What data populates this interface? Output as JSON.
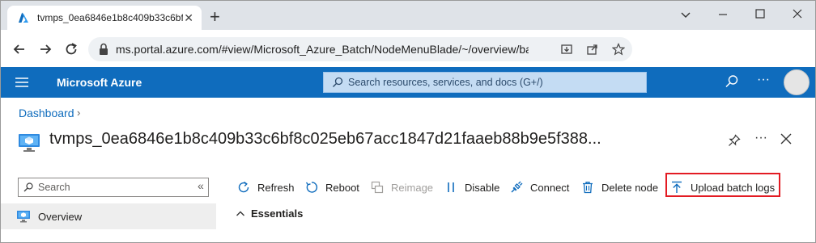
{
  "browser": {
    "tab_title": "tvmps_0ea6846e1b8c409b33c6bf",
    "url": "ms.portal.azure.com/#view/Microsoft_Azure_Batch/NodeMenuBlade/~/overview/bat..."
  },
  "azure": {
    "brand": "Microsoft Azure",
    "search_placeholder": "Search resources, services, and docs (G+/)"
  },
  "page": {
    "breadcrumb": "Dashboard",
    "title": "tvmps_0ea6846e1b8c409b33c6bf8c025eb67acc1847d21faaeb88b9e5f388..."
  },
  "sidebar": {
    "search_placeholder": "Search",
    "items": [
      {
        "label": "Overview",
        "selected": true
      }
    ]
  },
  "toolbar": {
    "refresh": "Refresh",
    "reboot": "Reboot",
    "reimage": "Reimage",
    "disable": "Disable",
    "connect": "Connect",
    "delete_node": "Delete node",
    "upload_batch_logs": "Upload batch logs"
  },
  "essentials": {
    "label": "Essentials"
  },
  "colors": {
    "azure_header": "#0f6cbd",
    "highlight": "#e31b23",
    "link": "#0f6cbd"
  }
}
